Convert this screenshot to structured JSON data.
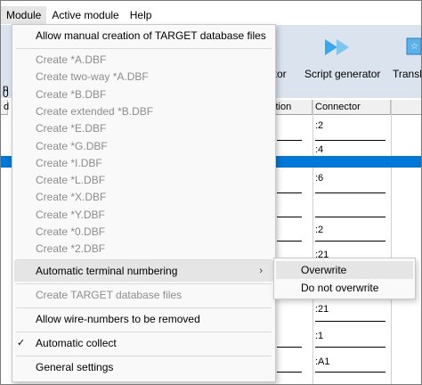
{
  "menubar": {
    "items": [
      {
        "label": "Module",
        "active": true
      },
      {
        "label": "Active module",
        "active": false
      },
      {
        "label": "Help",
        "active": false
      }
    ]
  },
  "toolbar": {
    "partial_label_left": "ator",
    "script_generator_label": "Script generator",
    "partial_label_right": "Transla",
    "left_edge_row1": "n",
    "left_edge_row2": "0"
  },
  "grid": {
    "headers": {
      "partial_left": "d",
      "partial_mid": "ction",
      "connector": "Connector"
    },
    "connector_values": [
      ":2",
      ":4",
      ":6",
      ":2",
      ":21",
      ":21",
      ":1",
      ":A1"
    ],
    "selected_row_color": "#0078d7"
  },
  "dropdown": {
    "allow_manual": "Allow manual creation of TARGET database files",
    "create_items": [
      "Create *A.DBF",
      "Create two-way *A.DBF",
      "Create *B.DBF",
      "Create extended *B.DBF",
      "Create *E.DBF",
      "Create *G.DBF",
      "Create *I.DBF",
      "Create *L.DBF",
      "Create *X.DBF",
      "Create *Y.DBF",
      "Create *0.DBF",
      "Create *2.DBF"
    ],
    "auto_terminal": "Automatic terminal numbering",
    "create_target": "Create TARGET database files",
    "allow_wire": "Allow wire-numbers to be removed",
    "auto_collect": "Automatic collect",
    "auto_collect_checked": true,
    "general_settings": "General settings"
  },
  "submenu": {
    "overwrite": "Overwrite",
    "do_not_overwrite": "Do not overwrite"
  }
}
